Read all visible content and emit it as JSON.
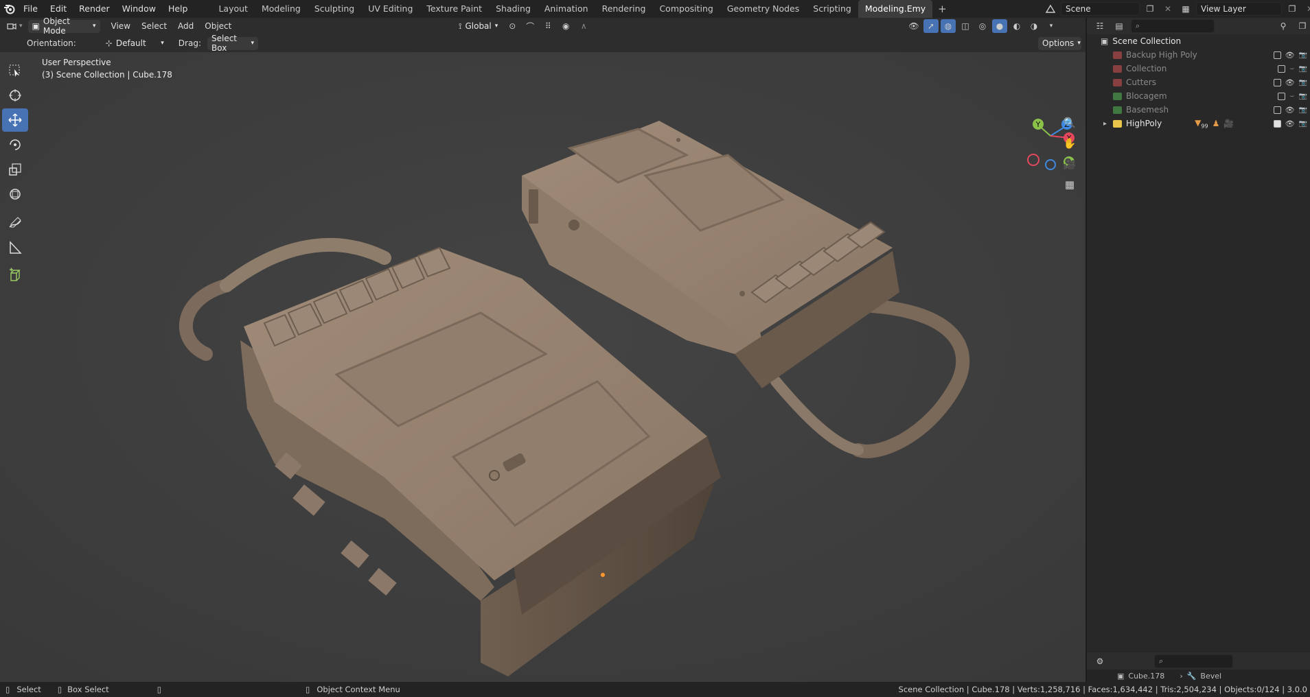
{
  "topbar": {
    "menus": [
      "File",
      "Edit",
      "Render",
      "Window",
      "Help"
    ],
    "workspaces": [
      "Layout",
      "Modeling",
      "Sculpting",
      "UV Editing",
      "Texture Paint",
      "Shading",
      "Animation",
      "Rendering",
      "Compositing",
      "Geometry Nodes",
      "Scripting",
      "Modeling.Emy"
    ],
    "active_workspace": "Modeling.Emy",
    "add_tab": "+",
    "scene_name": "Scene",
    "view_layer_name": "View Layer"
  },
  "viewport_header": {
    "mode": "Object Mode",
    "menus": [
      "View",
      "Select",
      "Add",
      "Object"
    ],
    "transform_orientation": "Global"
  },
  "tool_settings": {
    "orientation_label": "Orientation:",
    "orientation_value": "Default",
    "drag_label": "Drag:",
    "drag_value": "Select Box",
    "options_label": "Options"
  },
  "viewport": {
    "perspective_label": "User Perspective",
    "collection_label": "(3) Scene Collection | Cube.178",
    "gizmo": {
      "x": "X",
      "y": "Y",
      "z": "Z"
    },
    "colors": {
      "x_axis": "#e5485e",
      "y_axis": "#8bc34a",
      "z_axis": "#3f8ae0",
      "model": "#8d7a68"
    }
  },
  "outliner": {
    "root": "Scene Collection",
    "items": [
      {
        "label": "Backup High Poly",
        "color": "#b04848",
        "dim": true
      },
      {
        "label": "Collection",
        "color": "#b04848",
        "dim": true
      },
      {
        "label": "Cutters",
        "color": "#b04848",
        "dim": true
      },
      {
        "label": "Blocagem",
        "color": "#4c9a4c",
        "dim": true
      },
      {
        "label": "Basemesh",
        "color": "#4c9a4c",
        "dim": true
      },
      {
        "label": "HighPoly",
        "color": "#e8c64a",
        "dim": false
      }
    ],
    "modifier_count": "99"
  },
  "properties": {
    "object_name": "Cube.178",
    "modifier_name": "Bevel"
  },
  "statusbar": {
    "select": "Select",
    "box_select": "Box Select",
    "context_menu": "Object Context Menu",
    "stats": "Scene Collection | Cube.178 | Verts:1,258,716 | Faces:1,634,442 | Tris:2,504,234 | Objects:0/124 | 3.0.0"
  }
}
